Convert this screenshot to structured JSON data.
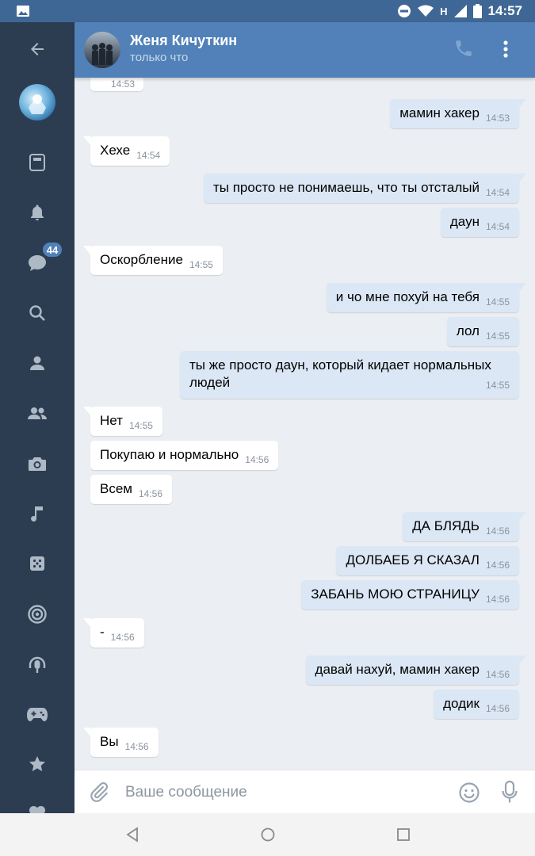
{
  "status_bar": {
    "time": "14:57",
    "network": "H",
    "colors": {
      "background": "#3e6796"
    }
  },
  "sidebar": {
    "badge_count": "44",
    "icons": [
      "back-arrow-icon",
      "profile-avatar",
      "news-icon",
      "notifications-bell-icon",
      "messages-icon",
      "search-icon",
      "profile-icon",
      "friends-icon",
      "camera-icon",
      "music-icon",
      "games-icon",
      "target-icon",
      "podcast-icon",
      "gamepad-icon",
      "star-icon",
      "heart-icon"
    ]
  },
  "header": {
    "name": "Женя Кичуткин",
    "status": "только что"
  },
  "messages": [
    {
      "dir": "in",
      "text": "",
      "time": "14:53"
    },
    {
      "dir": "out",
      "text": "мамин хакер",
      "time": "14:53"
    },
    {
      "dir": "in",
      "text": "Хехе",
      "time": "14:54"
    },
    {
      "dir": "out",
      "text": "ты просто не понимаешь, что ты отсталый",
      "time": "14:54"
    },
    {
      "dir": "out",
      "text": "даун",
      "time": "14:54"
    },
    {
      "dir": "in",
      "text": "Оскорбление",
      "time": "14:55"
    },
    {
      "dir": "out",
      "text": "и чо мне похуй на тебя",
      "time": "14:55"
    },
    {
      "dir": "out",
      "text": "лол",
      "time": "14:55"
    },
    {
      "dir": "out",
      "text": "ты же просто даун, который кидает нормальных людей",
      "time": "14:55"
    },
    {
      "dir": "in",
      "text": "Нет",
      "time": "14:55"
    },
    {
      "dir": "in",
      "text": "Покупаю и нормально",
      "time": "14:56"
    },
    {
      "dir": "in",
      "text": "Всем",
      "time": "14:56"
    },
    {
      "dir": "out",
      "text": "ДА БЛЯДЬ",
      "time": "14:56"
    },
    {
      "dir": "out",
      "text": "ДОЛБАЕБ Я СКАЗАЛ",
      "time": "14:56"
    },
    {
      "dir": "out",
      "text": "ЗАБАНЬ МОЮ СТРАНИЦУ",
      "time": "14:56"
    },
    {
      "dir": "in",
      "text": "-",
      "time": "14:56"
    },
    {
      "dir": "out",
      "text": "давай нахуй, мамин хакер",
      "time": "14:56"
    },
    {
      "dir": "out",
      "text": "додик",
      "time": "14:56"
    },
    {
      "dir": "in",
      "text": "Вы",
      "time": "14:56"
    }
  ],
  "input": {
    "placeholder": "Ваше сообщение"
  },
  "colors": {
    "header": "#5181b8",
    "sidebar": "#2c3d52",
    "chat_background": "#ebeef2",
    "incoming_bubble": "#ffffff",
    "outgoing_bubble": "#dbe7f4"
  }
}
